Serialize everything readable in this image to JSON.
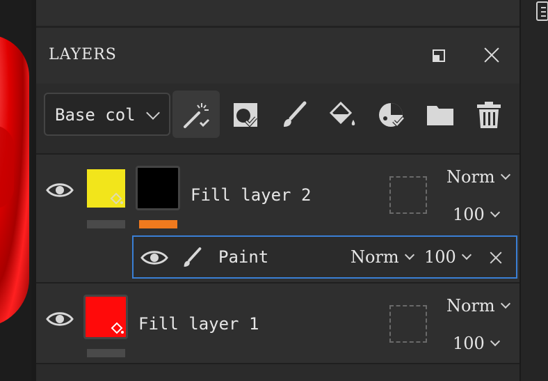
{
  "panel": {
    "title": "LAYERS"
  },
  "toolbar": {
    "channel_dropdown": {
      "value": "Base col"
    },
    "tools": [
      "magic-wand-icon",
      "mask-icon",
      "brush-icon",
      "fill-bucket-icon",
      "smart-mask-icon",
      "folder-icon",
      "trash-icon"
    ]
  },
  "layers": [
    {
      "name": "Fill layer 2",
      "color_swatch": "#f2e51b",
      "mask_swatch": "#000000",
      "mask_bar_color": "#f07a1e",
      "blend_mode": "Norm",
      "opacity": "100",
      "effects": [
        {
          "name": "Paint",
          "blend_mode": "Norm",
          "opacity": "100"
        }
      ]
    },
    {
      "name": "Fill layer 1",
      "color_swatch": "#ff0a0a",
      "blend_mode": "Norm",
      "opacity": "100"
    }
  ],
  "colors": {
    "accent_selection": "#3a7fd5",
    "panel_bg": "#2f2f2f"
  }
}
